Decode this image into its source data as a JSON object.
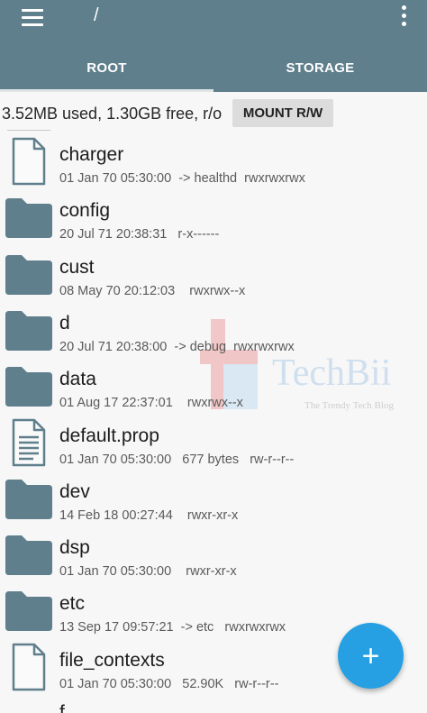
{
  "appbar": {
    "path": "/",
    "tabs": [
      {
        "label": "ROOT",
        "active": true
      },
      {
        "label": "STORAGE",
        "active": false
      }
    ],
    "color": "#5f7f8c"
  },
  "status": {
    "usage": "3.52MB used, 1.30GB free, r/o",
    "mount_label": "MOUNT R/W"
  },
  "files": [
    {
      "name": "charger",
      "meta": "01 Jan 70 05:30:00  -> healthd  rwxrwxrwx",
      "icon": "file-icon"
    },
    {
      "name": "config",
      "meta": "20 Jul 71 20:38:31   r-x------",
      "icon": "folder-icon"
    },
    {
      "name": "cust",
      "meta": "08 May 70 20:12:03    rwxrwx--x",
      "icon": "folder-icon"
    },
    {
      "name": "d",
      "meta": "20 Jul 71 20:38:00  -> debug  rwxrwxrwx",
      "icon": "folder-icon"
    },
    {
      "name": "data",
      "meta": "01 Aug 17 22:37:01    rwxrwx--x",
      "icon": "folder-icon"
    },
    {
      "name": "default.prop",
      "meta": "01 Jan 70 05:30:00   677 bytes   rw-r--r--",
      "icon": "document-icon"
    },
    {
      "name": "dev",
      "meta": "14 Feb 18 00:27:44    rwxr-xr-x",
      "icon": "folder-icon"
    },
    {
      "name": "dsp",
      "meta": "01 Jan 70 05:30:00    rwxr-xr-x",
      "icon": "folder-icon"
    },
    {
      "name": "etc",
      "meta": "13 Sep 17 09:57:21  -> etc   rwxrwxrwx",
      "icon": "folder-icon"
    },
    {
      "name": "file_contexts",
      "meta": "01 Jan 70 05:30:00   52.90K   rw-r--r--",
      "icon": "file-icon"
    }
  ],
  "partial_next": "f",
  "watermark": {
    "brand": "TechBii",
    "tagline": "The Trendy Tech Blog"
  },
  "fab": {
    "symbol": "+",
    "color": "#26a0e3"
  },
  "colors": {
    "icon": "#5f7f8c",
    "background": "#f7f7f7"
  }
}
